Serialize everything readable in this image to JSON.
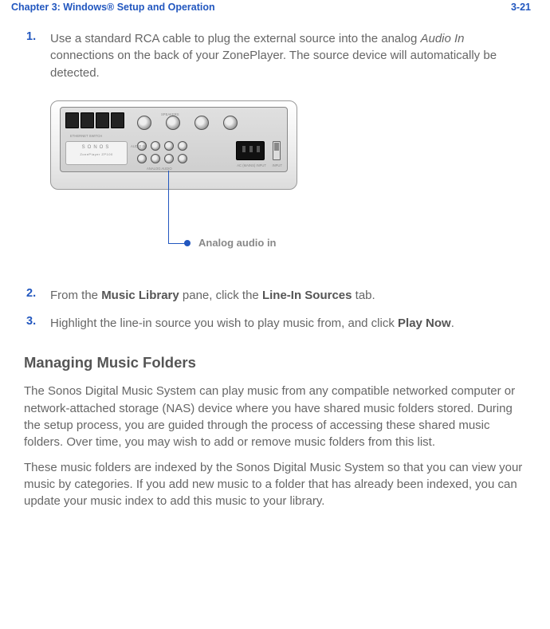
{
  "header": {
    "chapter": "Chapter 3:  Windows® Setup and Operation",
    "page": "3-21"
  },
  "steps": [
    {
      "num": "1.",
      "pre": "Use a standard RCA cable to plug the external source into the analog ",
      "em": "Audio In",
      "post": " connections on the back of your ZonePlayer. The source device will automatically be detected."
    },
    {
      "num": "2.",
      "pre": "From the ",
      "b1": "Music Library",
      "mid": " pane, click the ",
      "b2": "Line-In Sources",
      "post": " tab."
    },
    {
      "num": "3.",
      "pre": "Highlight the line-in source you wish to play music from, and click ",
      "b1": "Play Now",
      "post": "."
    }
  ],
  "figure": {
    "callout": "Analog audio in",
    "logo": "SONOS",
    "sublogo": "ZonePlayer ZP100"
  },
  "section": {
    "heading": "Managing Music Folders",
    "p1": "The Sonos Digital Music System can play music from any compatible networked computer or network-attached storage (NAS) device where you have shared music folders stored. During the setup process, you are guided through the process of accessing these shared music folders. Over time, you may wish to add or remove music folders from this list.",
    "p2": "These music folders are indexed by the Sonos Digital Music System so that you can view your music by categories. If you add new music to a folder that has already been indexed, you can update your music index to add this music to your library."
  }
}
